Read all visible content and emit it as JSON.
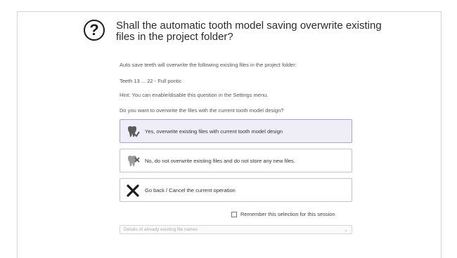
{
  "dialog": {
    "title": "Shall the automatic tooth model saving overwrite existing files in the project folder?",
    "info_line": "Auto save teeth will overwrite the following existing files in the project folder:",
    "files_line": "Teeth 13 ... 22 - Full pontic",
    "hint_line": "Hint: You can enable/disable this question in the Settings menu.",
    "question_line": "Do you want to overwrite the files with the current tooth model design?"
  },
  "options": [
    {
      "label": "Yes, overwrite existing files with current tooth model design",
      "icon": "tooth-save-icon",
      "selected": true
    },
    {
      "label": "No, do not overwrite existing files and do not store any new files.",
      "icon": "tooth-no-save-icon",
      "selected": false
    },
    {
      "label": "Go back / Cancel the current operation",
      "icon": "cancel-x-icon",
      "selected": false
    }
  ],
  "remember": {
    "label": "Remember this selection for this session",
    "checked": false
  },
  "details": {
    "label": "Details of already existing file names"
  },
  "colors": {
    "selected_bg": "#efedf7",
    "border": "#c4c4c4",
    "frame": "#cfd4e4"
  }
}
